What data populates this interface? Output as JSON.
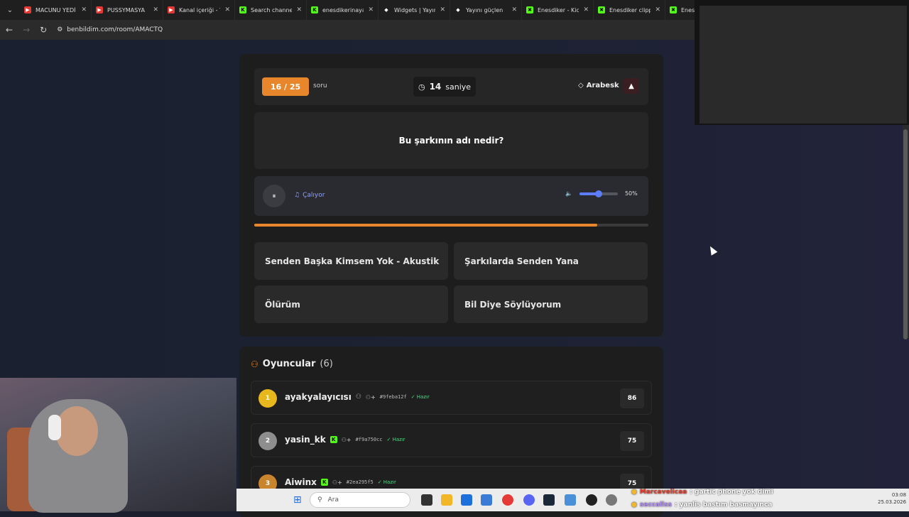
{
  "browser": {
    "tabs": [
      {
        "label": "MACUNU YEDİ",
        "color": "#e53935",
        "glyph": "▶"
      },
      {
        "label": "PUSSYMASYA",
        "color": "#e53935",
        "glyph": "▶"
      },
      {
        "label": "Kanal içeriği - Y",
        "color": "#e53935",
        "glyph": "▶"
      },
      {
        "label": "Search channel",
        "color": "#53fc18",
        "glyph": "K"
      },
      {
        "label": "enesdikerinaya",
        "color": "#53fc18",
        "glyph": "K"
      },
      {
        "label": "Widgets | Yayın",
        "color": "#ffffff",
        "glyph": "◆"
      },
      {
        "label": "Yayını güçlen",
        "color": "#ffffff",
        "glyph": "◆"
      },
      {
        "label": "Enesdiker - Kic",
        "color": "#53fc18",
        "glyph": "✖"
      },
      {
        "label": "Enesdiker clipp",
        "color": "#53fc18",
        "glyph": "✖"
      },
      {
        "label": "Enesdi",
        "color": "#53fc18",
        "glyph": "✖"
      }
    ],
    "url": "benbildim.com/room/AMACTQ"
  },
  "quiz": {
    "counter": "16 / 25",
    "counter_suffix": "soru",
    "timer_value": "14",
    "timer_unit": "saniye",
    "genre": "Arabesk",
    "question": "Bu şarkının adı nedir?",
    "status": "Çalıyor",
    "volume_label": "50%",
    "volume": 0.5,
    "progress": 0.87,
    "answers": [
      "Senden Başka Kimsem Yok - Akustik",
      "Şarkılarda Senden Yana",
      "Ölürüm",
      "Bil Diye Söylüyorum"
    ]
  },
  "players": {
    "title": "Oyuncular",
    "count": "(6)",
    "rows": [
      {
        "rank": "1",
        "name": "ayakyalayıcısı",
        "id": "#9feba12f",
        "status": "Hazır",
        "score": "86",
        "color": "#e6b81e"
      },
      {
        "rank": "2",
        "name": "yasin_kk",
        "id": "#f9a750cc",
        "status": "Hazır",
        "score": "75",
        "color": "#8e8e8e"
      },
      {
        "rank": "3",
        "name": "Aiwinx",
        "id": "#2ea295f5",
        "status": "Hazır",
        "score": "75",
        "color": "#c9842e"
      }
    ]
  },
  "taskbar": {
    "search_placeholder": "Ara",
    "time": "03:08",
    "date": "25.03.2026"
  },
  "chat": [
    {
      "user": "Marcavelicaa",
      "text": ": gartic phone yok dimi"
    },
    {
      "user": "seccallss",
      "text": ": yanlis bastım basmayınca"
    }
  ]
}
